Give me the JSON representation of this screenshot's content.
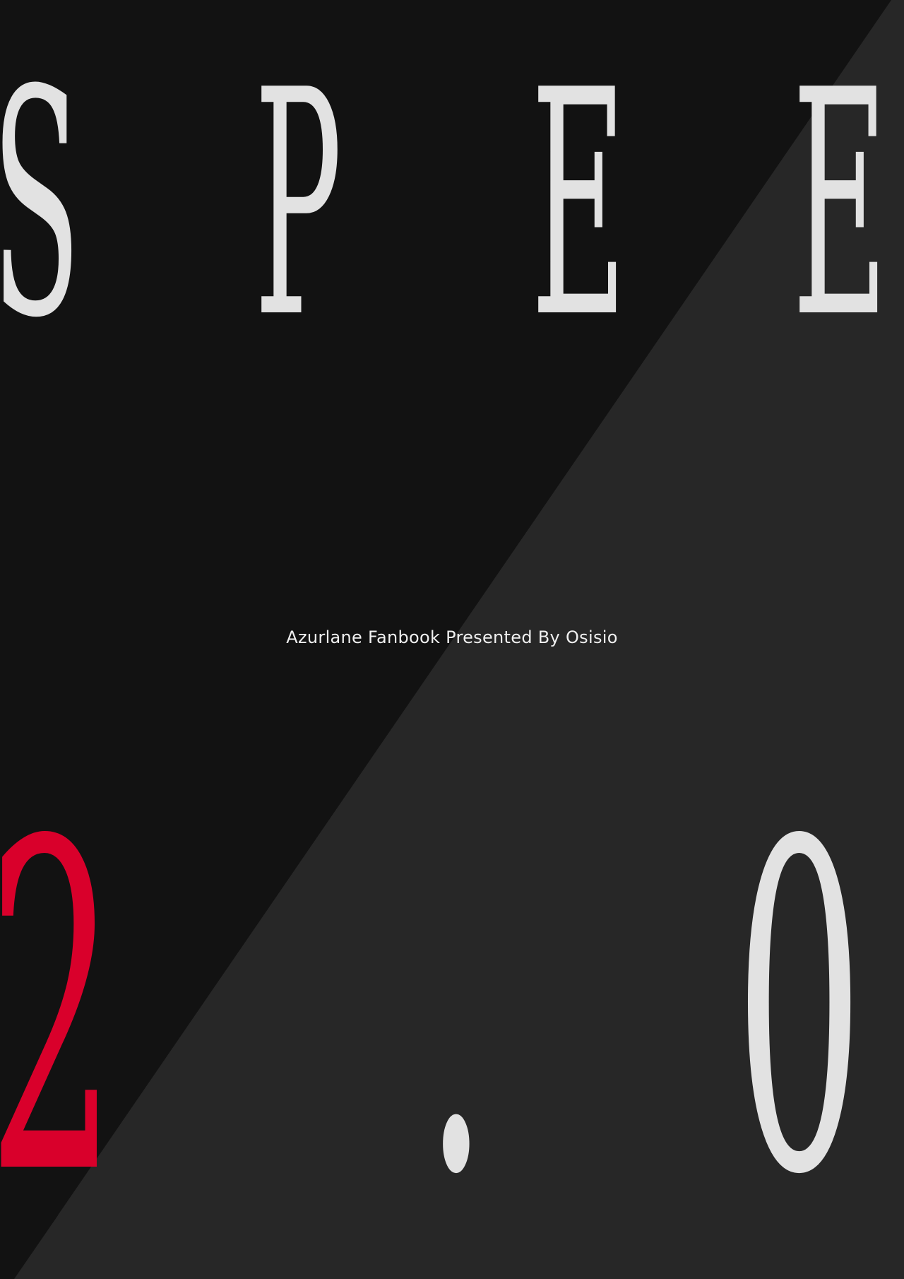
{
  "title": {
    "letters": [
      "S",
      "P",
      "E",
      "E"
    ]
  },
  "version": {
    "digit_major": "2",
    "separator": ".",
    "digit_minor": "0"
  },
  "subtitle": "Azurlane Fanbook Presented By Osisio",
  "colors": {
    "background_dark": "#121212",
    "background_light": "#272727",
    "text_light": "#e2e2e2",
    "accent_red": "#d9002b"
  }
}
